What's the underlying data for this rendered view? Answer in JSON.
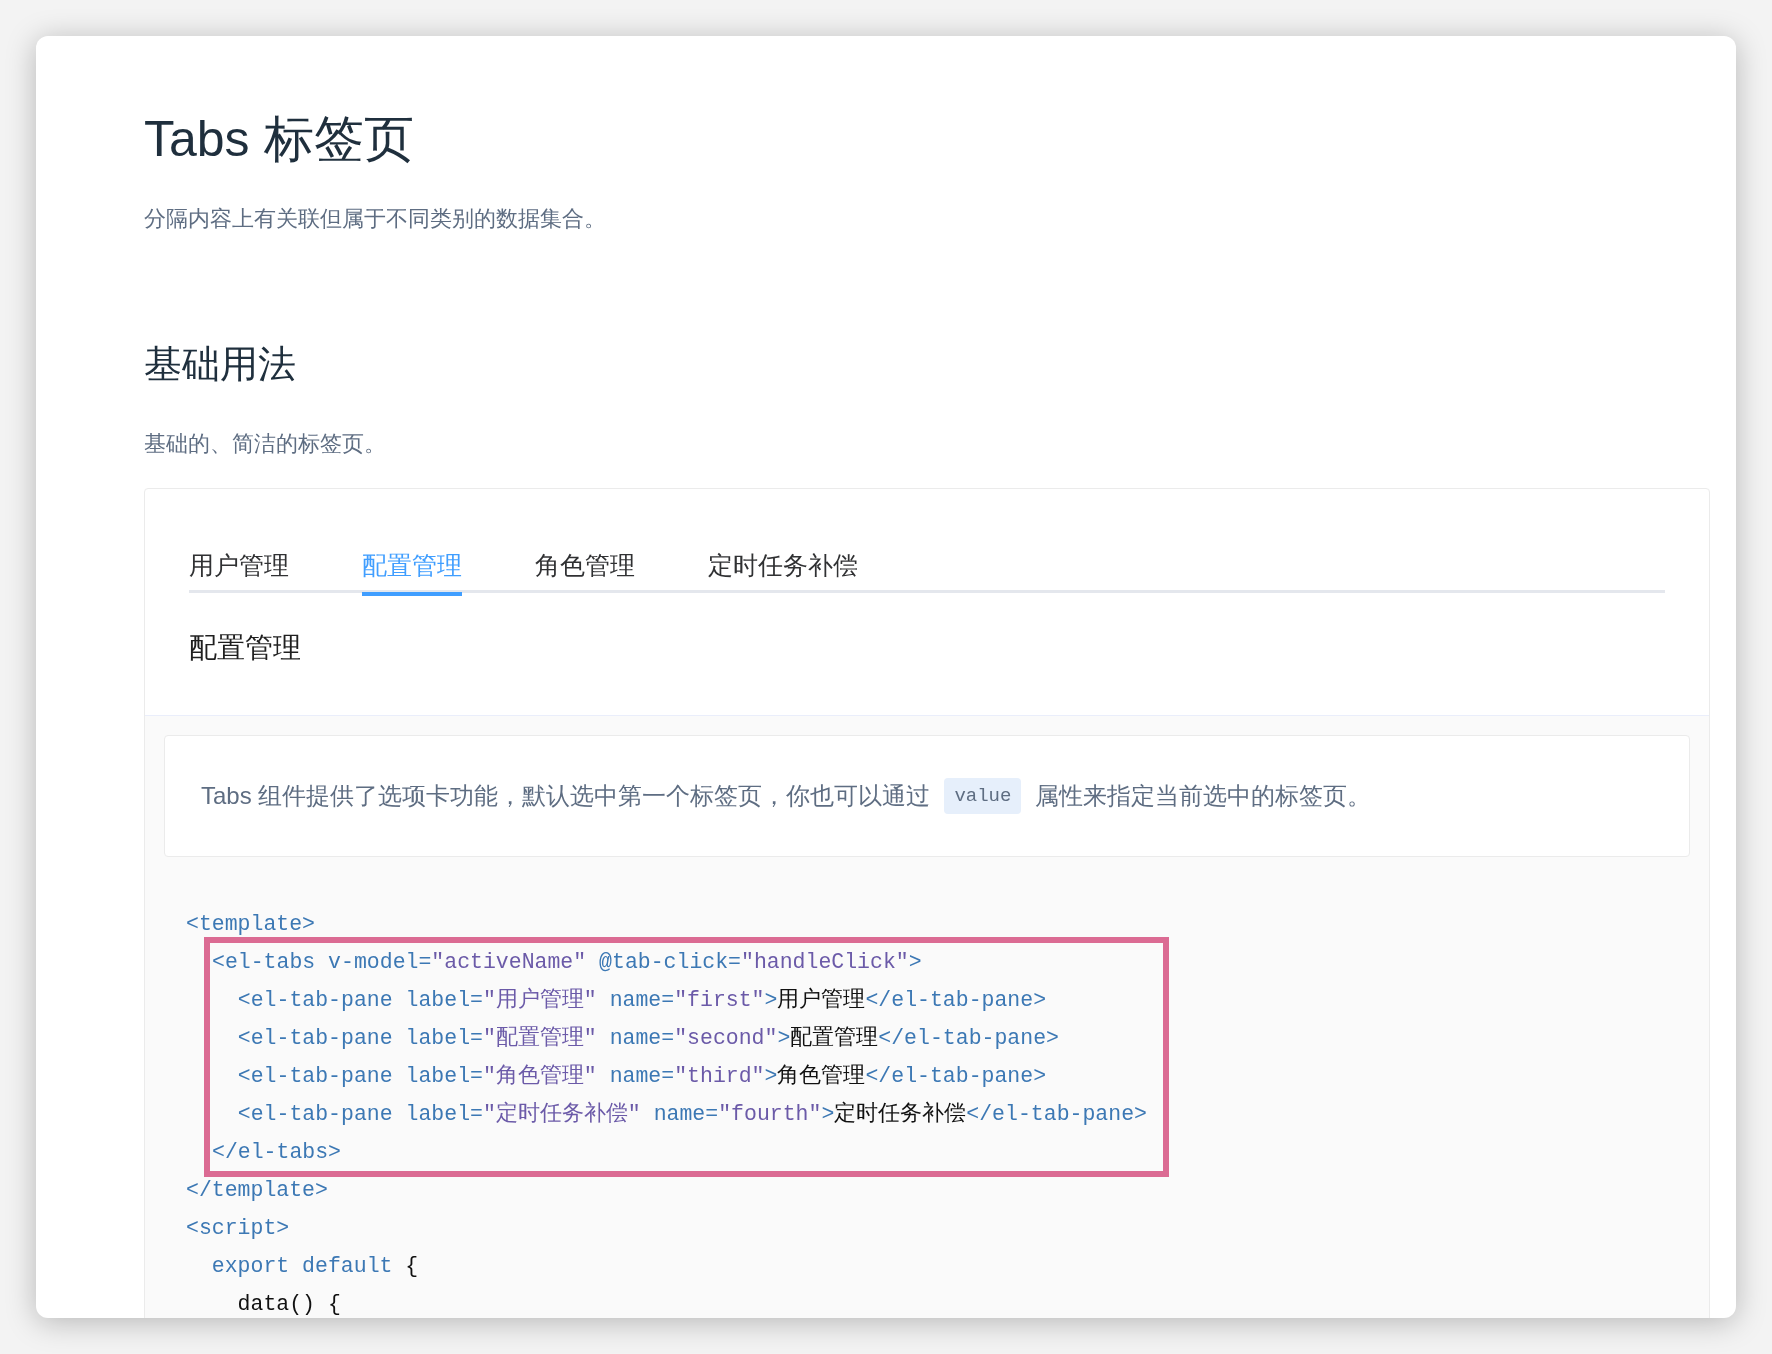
{
  "title": "Tabs 标签页",
  "subtitle": "分隔内容上有关联但属于不同类别的数据集合。",
  "section": {
    "heading": "基础用法",
    "description": "基础的、简洁的标签页。"
  },
  "demo": {
    "tabs": [
      {
        "label": "用户管理",
        "selected": false
      },
      {
        "label": "配置管理",
        "selected": true
      },
      {
        "label": "角色管理",
        "selected": false
      },
      {
        "label": "定时任务补偿",
        "selected": false
      }
    ],
    "pane_text": "配置管理"
  },
  "tip": {
    "before": "Tabs 组件提供了选项卡功能，默认选中第一个标签页，你也可以通过",
    "code": "value",
    "after": "属性来指定当前选中的标签页。"
  },
  "code": [
    {
      "highlighted": false,
      "lines": [
        [
          {
            "kind": "tag",
            "text": "<template>"
          }
        ]
      ]
    },
    {
      "highlighted": true,
      "lines": [
        [
          {
            "kind": "tag",
            "text": "<el-tabs v-model="
          },
          {
            "kind": "string",
            "text": "\"activeName\""
          },
          {
            "kind": "tag",
            "text": " @tab-click="
          },
          {
            "kind": "string",
            "text": "\"handleClick\""
          },
          {
            "kind": "tag",
            "text": ">"
          }
        ],
        [
          {
            "kind": "tag",
            "text": "  <el-tab-pane label="
          },
          {
            "kind": "string",
            "text": "\"用户管理\""
          },
          {
            "kind": "tag",
            "text": " name="
          },
          {
            "kind": "string",
            "text": "\"first\""
          },
          {
            "kind": "tag",
            "text": ">"
          },
          {
            "kind": "plain",
            "text": "用户管理"
          },
          {
            "kind": "tag",
            "text": "</el-tab-pane>"
          }
        ],
        [
          {
            "kind": "tag",
            "text": "  <el-tab-pane label="
          },
          {
            "kind": "string",
            "text": "\"配置管理\""
          },
          {
            "kind": "tag",
            "text": " name="
          },
          {
            "kind": "string",
            "text": "\"second\""
          },
          {
            "kind": "tag",
            "text": ">"
          },
          {
            "kind": "plain",
            "text": "配置管理"
          },
          {
            "kind": "tag",
            "text": "</el-tab-pane>"
          }
        ],
        [
          {
            "kind": "tag",
            "text": "  <el-tab-pane label="
          },
          {
            "kind": "string",
            "text": "\"角色管理\""
          },
          {
            "kind": "tag",
            "text": " name="
          },
          {
            "kind": "string",
            "text": "\"third\""
          },
          {
            "kind": "tag",
            "text": ">"
          },
          {
            "kind": "plain",
            "text": "角色管理"
          },
          {
            "kind": "tag",
            "text": "</el-tab-pane>"
          }
        ],
        [
          {
            "kind": "tag",
            "text": "  <el-tab-pane label="
          },
          {
            "kind": "string",
            "text": "\"定时任务补偿\""
          },
          {
            "kind": "tag",
            "text": " name="
          },
          {
            "kind": "string",
            "text": "\"fourth\""
          },
          {
            "kind": "tag",
            "text": ">"
          },
          {
            "kind": "plain",
            "text": "定时任务补偿"
          },
          {
            "kind": "tag",
            "text": "</el-tab-pane>"
          }
        ],
        [
          {
            "kind": "tag",
            "text": "</el-tabs>"
          }
        ]
      ]
    },
    {
      "highlighted": false,
      "lines": [
        [
          {
            "kind": "tag",
            "text": "</template>"
          }
        ],
        [
          {
            "kind": "tag",
            "text": "<script>"
          }
        ],
        [
          {
            "kind": "tag",
            "text": "  export default"
          },
          {
            "kind": "plain",
            "text": " {"
          }
        ],
        [
          {
            "kind": "plain",
            "text": "    data() {"
          }
        ]
      ]
    }
  ]
}
